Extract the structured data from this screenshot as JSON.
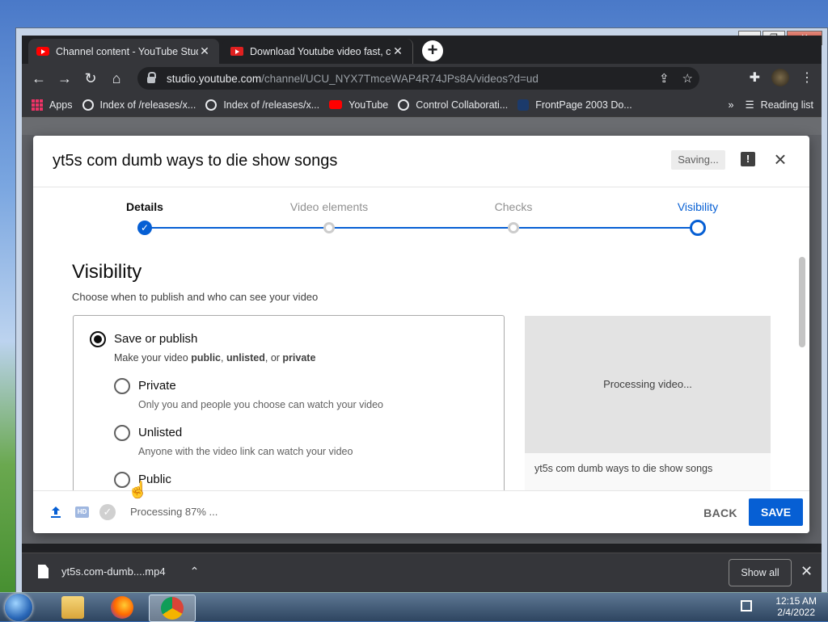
{
  "browser": {
    "tabs": [
      {
        "title": "Channel content - YouTube Studio",
        "active": true
      },
      {
        "title": "Download Youtube video fast, co",
        "active": false
      }
    ],
    "url_host": "studio.youtube.com",
    "url_path": "/channel/UCU_NYX7TmceWAP4R74JPs8A/videos?d=ud",
    "bookmarks": [
      {
        "label": "Apps",
        "icon": "apps-grid-icon"
      },
      {
        "label": "Index of /releases/x...",
        "icon": "globe-icon"
      },
      {
        "label": "Index of /releases/x...",
        "icon": "globe-icon"
      },
      {
        "label": "YouTube",
        "icon": "youtube-icon"
      },
      {
        "label": "Control Collaborati...",
        "icon": "globe-icon"
      },
      {
        "label": "FrontPage 2003 Do...",
        "icon": "frontpage-icon"
      }
    ],
    "bookmarks_overflow": "»",
    "reading_list": "Reading list"
  },
  "dialog": {
    "title": "yt5s com dumb ways to die show songs",
    "saving_badge": "Saving...",
    "steps": [
      {
        "label": "Details",
        "state": "done"
      },
      {
        "label": "Video elements",
        "state": "pending"
      },
      {
        "label": "Checks",
        "state": "pending"
      },
      {
        "label": "Visibility",
        "state": "current"
      }
    ],
    "section_title": "Visibility",
    "section_subtitle": "Choose when to publish and who can see your video",
    "save_or_publish": {
      "label": "Save or publish",
      "desc_prefix": "Make your video ",
      "desc_public": "public",
      "desc_sep1": ", ",
      "desc_unlisted": "unlisted",
      "desc_sep2": ", or ",
      "desc_private": "private",
      "selected": true
    },
    "options": [
      {
        "label": "Private",
        "desc": "Only you and people you choose can watch your video"
      },
      {
        "label": "Unlisted",
        "desc": "Anyone with the video link can watch your video"
      },
      {
        "label": "Public",
        "desc": ""
      }
    ],
    "preview": {
      "status": "Processing video...",
      "title": "yt5s com dumb ways to die show songs"
    },
    "footer": {
      "processing_text": "Processing 87% ...",
      "back_label": "BACK",
      "save_label": "SAVE"
    }
  },
  "downloads": {
    "file": "yt5s.com-dumb....mp4",
    "show_all": "Show all"
  },
  "taskbar": {
    "time": "12:15 AM",
    "date": "2/4/2022"
  },
  "colors": {
    "accent": "#065fd4",
    "chrome_dark": "#35363a",
    "youtube_red": "#ff0000"
  }
}
